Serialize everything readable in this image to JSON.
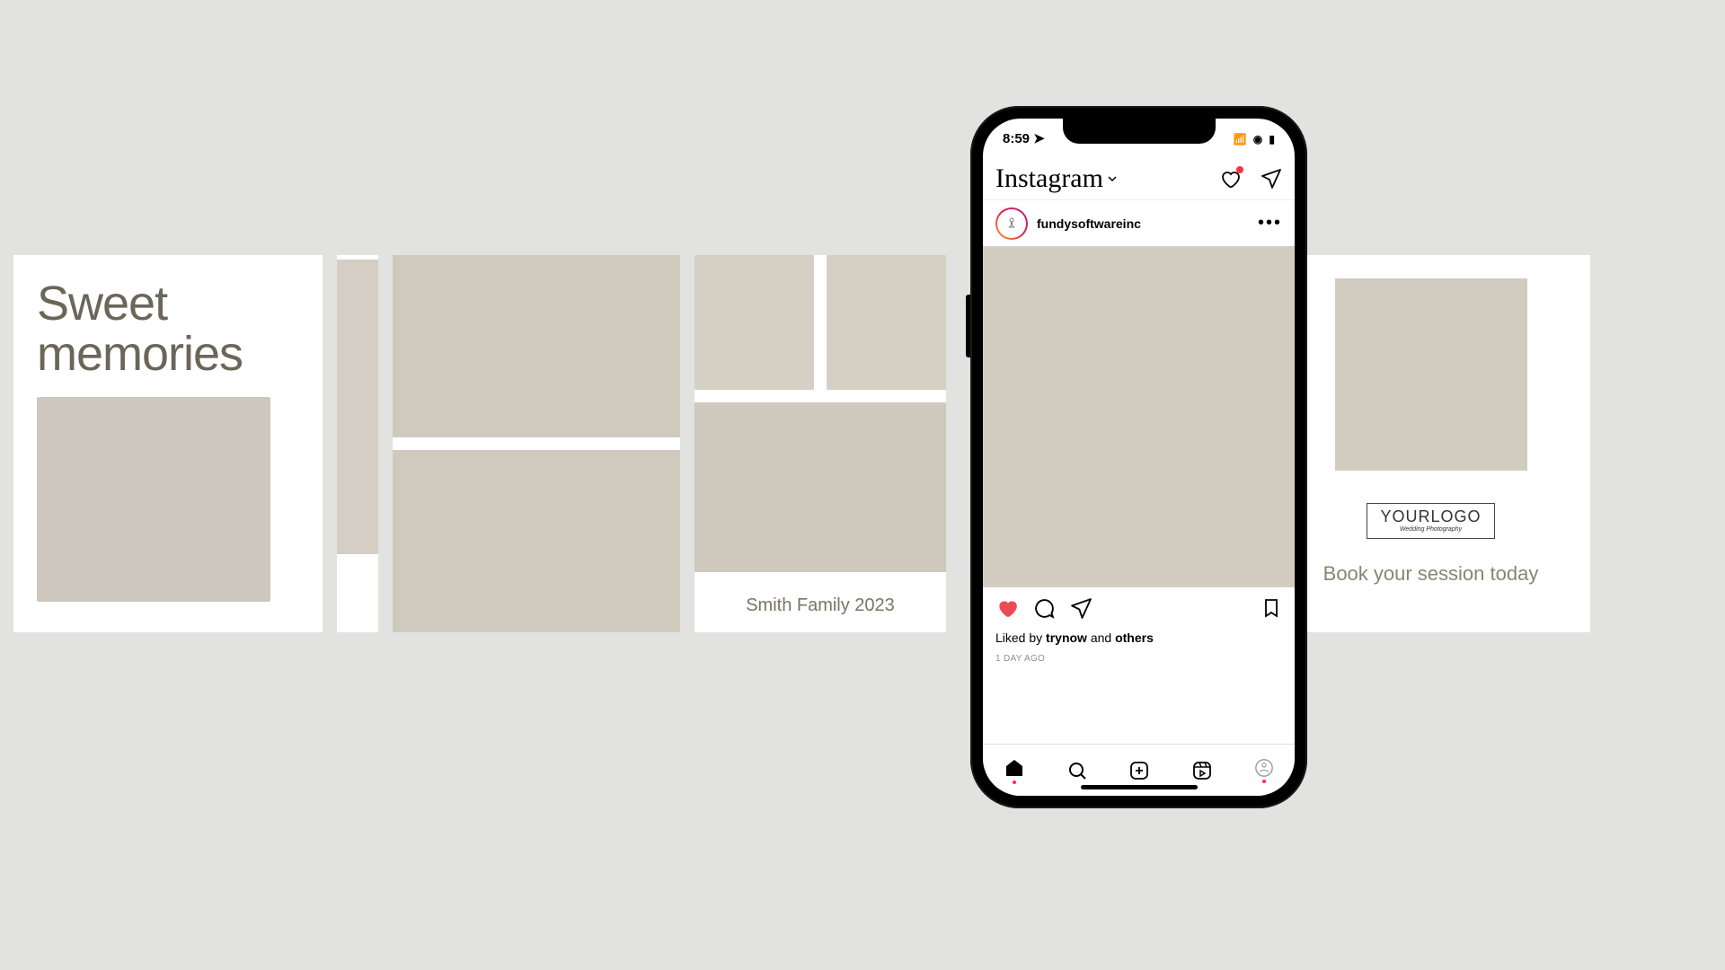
{
  "carousel": {
    "panel1_title_line1": "Sweet",
    "panel1_title_line2": "memories",
    "panel4_caption": "Smith Family 2023",
    "panel5_logo": "YOURLOGO",
    "panel5_logo_sub": "Wedding Photography",
    "panel5_cta": "Book your session today"
  },
  "phone": {
    "time": "8:59",
    "app_name": "Instagram",
    "post_username": "fundysoftwareinc",
    "likes_prefix": "Liked by",
    "likes_user": "trynow",
    "likes_mid": "and",
    "likes_suffix": "others",
    "age": "1 DAY AGO"
  }
}
